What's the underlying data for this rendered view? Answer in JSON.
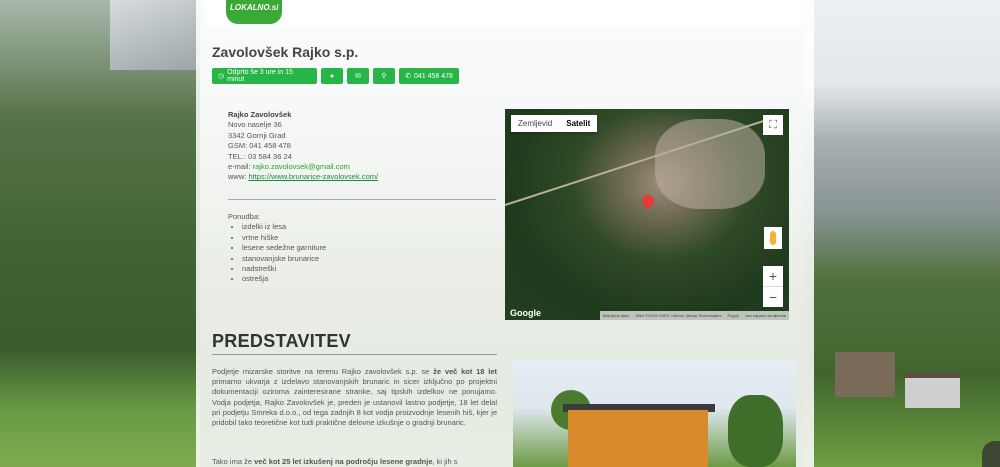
{
  "logo_text": "LOKALNO.si",
  "company": {
    "title": "Zavolovšek Rajko s.p.",
    "buttons": [
      {
        "label": "Odprto še 3 ure in 15 minut",
        "icon": "clock-icon"
      },
      {
        "label": "",
        "icon": "globe-icon"
      },
      {
        "label": "",
        "icon": "envelope-icon"
      },
      {
        "label": "",
        "icon": "map-marker-icon"
      },
      {
        "label": "041 458 478",
        "icon": "phone-icon"
      }
    ]
  },
  "contact": {
    "name": "Rajko Zavolovšek",
    "street": "Novo naselje 36",
    "city": "3342 Gornji Grad",
    "gsm": "GSM: 041 458 478",
    "tel": "TEL.: 03 584 36 24",
    "email_label": "e-mail:",
    "email": "rajko.zavolovsek@gmail.com",
    "www_label": "www:",
    "www": "https://www.brunarice-zavolovsek.com/"
  },
  "offer": {
    "heading": "Ponudba:",
    "items": [
      "izdelki iz lesa",
      "vrtne hiške",
      "lesene sedežne garniture",
      "stanovanjske brunarice",
      "nadstreški",
      "ostrešja"
    ]
  },
  "map": {
    "tab_map": "Zemljevid",
    "tab_satellite": "Satelit",
    "zoom_in": "+",
    "zoom_out": "−",
    "google": "Google",
    "attribution": [
      "Bližnjične tipke",
      "Slike ©2024 CNES / Airbus, Maxar Technologies",
      "Pogoji",
      "Javi napako zemljevida"
    ]
  },
  "intro": {
    "heading": "PREDSTAVITEV",
    "paragraph1_a": "Podjetje mizarske storitve na terenu Rajko zavolovšek s.p. se ",
    "paragraph1_b": "že več kot 18 let",
    "paragraph1_c": " primarno ukvarja z izdelavo stanovanjskih brunaric in sicer izključno po projektni dokumentaciji oziroma zainteresirane stranke, saj tipskih izdelkov ne ponujamo. Vodja podjetja, Rajko Zavolovšek je, preden je ustanovil lastno podjetje, 18 let delal pri podjetju Smreka d.o.o., od tega zadnjih 8 kot vodja proizvodnje lesenih hiš, kjer je pridobil tako teoretične kot tudi praktične delovne izkušnje o gradnji brunaric.",
    "paragraph2_a": "Tako ima že ",
    "paragraph2_b": "več kot 25 let izkušenj na področju lesene gradnje",
    "paragraph2_c": ", ki jih s"
  }
}
